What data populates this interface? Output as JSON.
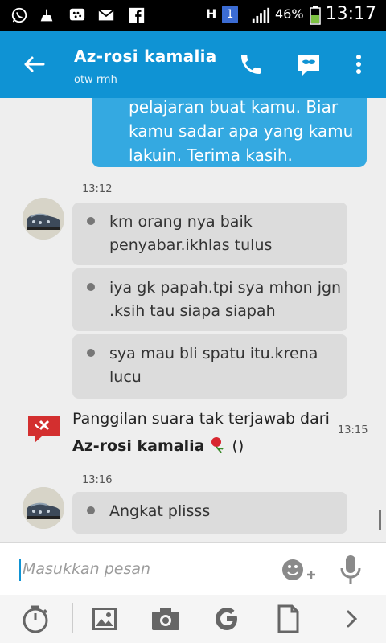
{
  "status_bar": {
    "network": "H",
    "sim": "1",
    "battery": "46%",
    "time": "13:17"
  },
  "header": {
    "contact_name": "Az-rosi kamalia",
    "contact_status": "otw rmh"
  },
  "messages": {
    "outgoing_partial": "pelajaran buat kamu. Biar kamu sadar apa yang kamu lakuin. Terima kasih.",
    "group1_time": "13:12",
    "incoming": [
      "km orang nya baik penyabar.ikhlas tulus",
      "iya gk papah.tpi sya mhon jgn .ksih tau siapa siapah",
      "sya mau bli spatu itu.krena lucu"
    ],
    "missed_call": {
      "text_prefix": "Panggilan suara tak terjawab dari ",
      "name": "Az-rosi kamalia",
      "suffix": " ()",
      "time": "13:15"
    },
    "group2_time": "13:16",
    "last_incoming": "Angkat plisss"
  },
  "composer": {
    "placeholder": "Masukkan pesan"
  },
  "icons": {
    "whatsapp": "whatsapp-icon",
    "bbm": "bbm-icon",
    "gmail": "gmail-icon",
    "facebook": "facebook-icon"
  },
  "colors": {
    "accent": "#0F93D4",
    "outgoing_bubble": "#34A9E1",
    "incoming_bubble": "#DCDCDC",
    "missed_call": "#D32F2F"
  }
}
